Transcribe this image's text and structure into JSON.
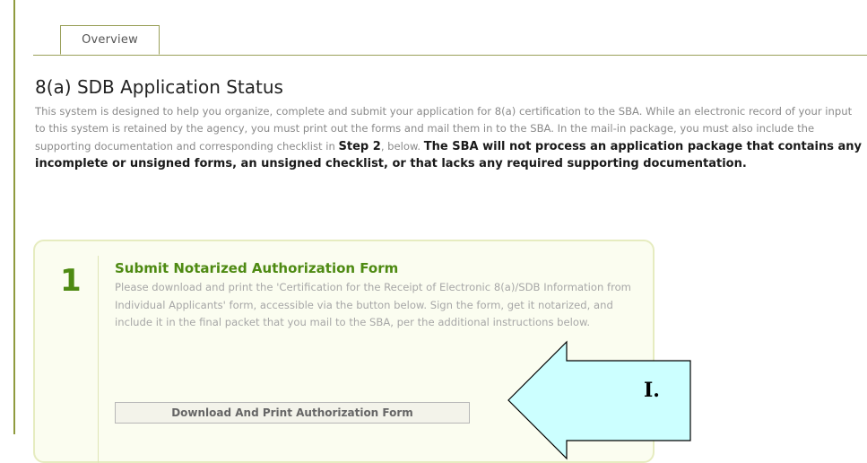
{
  "tabs": [
    {
      "label": "Overview",
      "active": true
    }
  ],
  "page_title": "8(a) SDB Application Status",
  "intro": {
    "text_1": "This system is designed to help you organize, complete and submit your application for 8(a) certification to the SBA. While an electronic record of your input to this system is retained by the agency, you must print out the forms and mail them in to the SBA. In the mail-in package, you must also include the supporting documentation and corresponding checklist in ",
    "step_ref": "Step 2",
    "text_2": ", below. ",
    "warning": "The SBA will not process an application package that contains any incomplete or unsigned forms, an unsigned checklist, or that lacks any required supporting documentation."
  },
  "steps": [
    {
      "number": "1",
      "title": "Submit Notarized Authorization Form",
      "description": "Please download and print the 'Certification for the Receipt of Electronic 8(a)/SDB Information from Individual Applicants' form, accessible via the button below. Sign the form, get it notarized, and include it in the final packet that you mail to the SBA, per the additional instructions below.",
      "button_label": "Download And Print Authorization Form"
    }
  ],
  "callout": {
    "label": "I.",
    "fill_color": "#ccffff",
    "stroke_color": "#000000",
    "direction": "left"
  },
  "colors": {
    "accent_green": "#4e8a12",
    "card_background": "#fbfdf0",
    "card_border": "#e6ecc0",
    "rule_olive": "#8f9a3e"
  }
}
